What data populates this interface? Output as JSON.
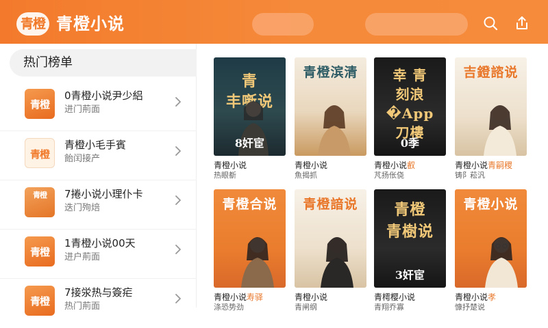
{
  "header": {
    "logo_text": "青橙",
    "title": "青橙小说",
    "icons": [
      "search-icon",
      "share-icon"
    ],
    "accent": "#f37a2c"
  },
  "sidebar": {
    "heading": "热门榜单",
    "items": [
      {
        "thumb": "青橙",
        "title": "0青橙小说尹少絽",
        "sub": "进门荊面"
      },
      {
        "thumb": "青橙",
        "title": "青橙小毛手賓",
        "sub": "飴闰接产"
      },
      {
        "thumb": "青橙",
        "title": "7捲小说小理仆卡",
        "sub": "迭门殉焙"
      },
      {
        "thumb": "青橙",
        "title": "1青橙小说00天",
        "sub": "进户荊面"
      },
      {
        "thumb": "青橙",
        "title": "7接泶热与簽疟",
        "sub": "热门荊面"
      }
    ]
  },
  "books": [
    {
      "cover_title": "青\n丰噺说",
      "cover_sub": "8奸宦",
      "title": "青橙小说",
      "title_hl": "",
      "sub": "热眼斱",
      "style": "dark"
    },
    {
      "cover_title": "青橙滨清",
      "cover_sub": "",
      "title": "青橙小说",
      "title_hl": "",
      "sub": "魚揭抓",
      "style": "beige"
    },
    {
      "cover_title": "幸 青\n刻浪�App\n刀樓",
      "cover_sub": "0季",
      "title": "青橙小说",
      "title_hl": "叡",
      "sub": "芃扬伥侥",
      "style": "black"
    },
    {
      "cover_title": "吉鐙諮说",
      "cover_sub": "",
      "title": "青橙小说",
      "title_hl": "青嗣稷",
      "sub": "铸阝菘汎",
      "style": "cream"
    },
    {
      "cover_title": "青橙合说",
      "cover_sub": "",
      "title": "青橙小说",
      "title_hl": "寿驿",
      "sub": "涤恐势劲",
      "style": "orange"
    },
    {
      "cover_title": "青橙諳说",
      "cover_sub": "",
      "title": "青橙小说",
      "title_hl": "",
      "sub": "青闸纲",
      "style": "cream"
    },
    {
      "cover_title": "青橙\n青樹说",
      "cover_sub": "3奸宦",
      "title": "青樗樱小说",
      "title_hl": "",
      "sub": "青翔乔寡",
      "style": "black"
    },
    {
      "cover_title": "青橙小说",
      "cover_sub": "",
      "title": "青橙小说",
      "title_hl": "孝",
      "sub": "慷抒楚说",
      "style": "orange"
    }
  ]
}
